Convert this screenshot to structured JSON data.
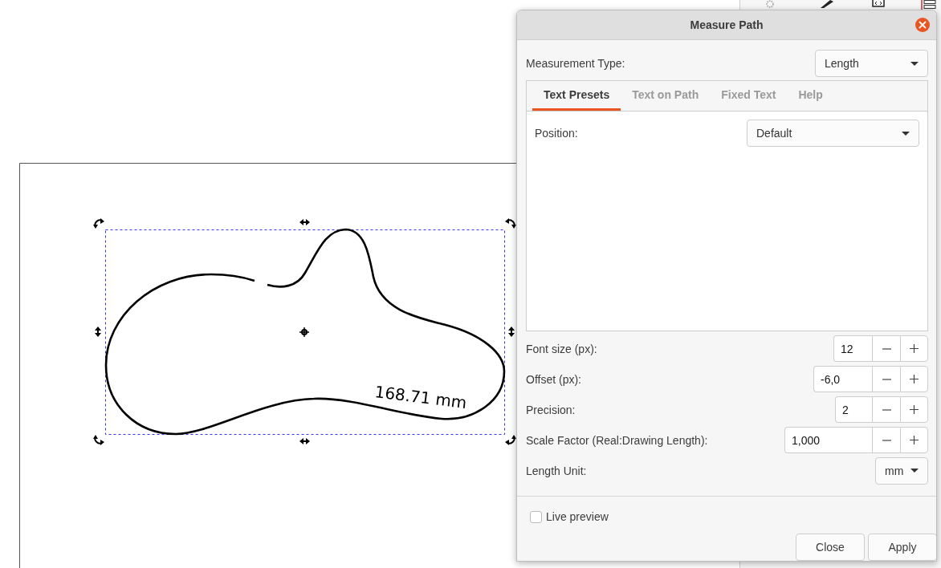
{
  "window": {
    "title": "Measure Path"
  },
  "measurement_type": {
    "label": "Measurement Type:",
    "value": "Length"
  },
  "tabs": [
    {
      "label": "Text Presets",
      "selected": true
    },
    {
      "label": "Text on Path",
      "selected": false
    },
    {
      "label": "Fixed Text",
      "selected": false
    },
    {
      "label": "Help",
      "selected": false
    }
  ],
  "position": {
    "label": "Position:",
    "value": "Default"
  },
  "fields": [
    {
      "kind": "spin",
      "label": "Font size (px):",
      "value": "12"
    },
    {
      "kind": "spin",
      "label": "Offset (px):",
      "value": "-6,0"
    },
    {
      "kind": "spin",
      "label": "Precision:",
      "value": "2"
    },
    {
      "kind": "spin",
      "label": "Scale Factor (Real:Drawing Length):",
      "value": "1,000"
    },
    {
      "kind": "dropdown",
      "label": "Length Unit:",
      "value": "mm"
    }
  ],
  "live_preview": {
    "label": "Live preview",
    "checked": false
  },
  "buttons": [
    "Close",
    "Apply"
  ],
  "canvas": {
    "measurement_label": "168.71 mm"
  }
}
